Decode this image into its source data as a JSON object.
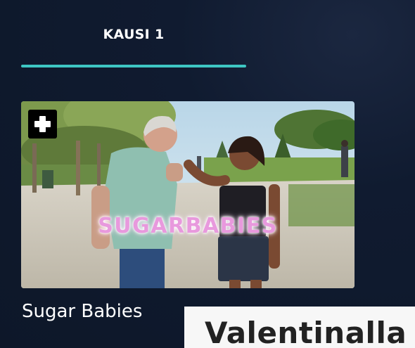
{
  "season_tabs": [
    {
      "label": "KAUSI 1",
      "active": true
    }
  ],
  "accent_color": "#3ec6c3",
  "episode_card": {
    "thumbnail_overlay_text": "SUGARBABIES",
    "title": "Sugar Babies",
    "add_icon": "plus-icon"
  },
  "popup": {
    "heading": "Valentinalla"
  }
}
